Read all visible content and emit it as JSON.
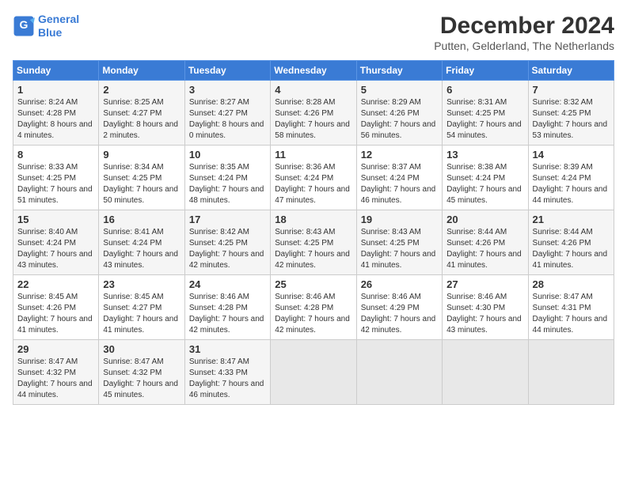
{
  "header": {
    "logo_line1": "General",
    "logo_line2": "Blue",
    "month": "December 2024",
    "location": "Putten, Gelderland, The Netherlands"
  },
  "weekdays": [
    "Sunday",
    "Monday",
    "Tuesday",
    "Wednesday",
    "Thursday",
    "Friday",
    "Saturday"
  ],
  "weeks": [
    [
      {
        "day": "1",
        "sunrise": "Sunrise: 8:24 AM",
        "sunset": "Sunset: 4:28 PM",
        "daylight": "Daylight: 8 hours and 4 minutes."
      },
      {
        "day": "2",
        "sunrise": "Sunrise: 8:25 AM",
        "sunset": "Sunset: 4:27 PM",
        "daylight": "Daylight: 8 hours and 2 minutes."
      },
      {
        "day": "3",
        "sunrise": "Sunrise: 8:27 AM",
        "sunset": "Sunset: 4:27 PM",
        "daylight": "Daylight: 8 hours and 0 minutes."
      },
      {
        "day": "4",
        "sunrise": "Sunrise: 8:28 AM",
        "sunset": "Sunset: 4:26 PM",
        "daylight": "Daylight: 7 hours and 58 minutes."
      },
      {
        "day": "5",
        "sunrise": "Sunrise: 8:29 AM",
        "sunset": "Sunset: 4:26 PM",
        "daylight": "Daylight: 7 hours and 56 minutes."
      },
      {
        "day": "6",
        "sunrise": "Sunrise: 8:31 AM",
        "sunset": "Sunset: 4:25 PM",
        "daylight": "Daylight: 7 hours and 54 minutes."
      },
      {
        "day": "7",
        "sunrise": "Sunrise: 8:32 AM",
        "sunset": "Sunset: 4:25 PM",
        "daylight": "Daylight: 7 hours and 53 minutes."
      }
    ],
    [
      {
        "day": "8",
        "sunrise": "Sunrise: 8:33 AM",
        "sunset": "Sunset: 4:25 PM",
        "daylight": "Daylight: 7 hours and 51 minutes."
      },
      {
        "day": "9",
        "sunrise": "Sunrise: 8:34 AM",
        "sunset": "Sunset: 4:25 PM",
        "daylight": "Daylight: 7 hours and 50 minutes."
      },
      {
        "day": "10",
        "sunrise": "Sunrise: 8:35 AM",
        "sunset": "Sunset: 4:24 PM",
        "daylight": "Daylight: 7 hours and 48 minutes."
      },
      {
        "day": "11",
        "sunrise": "Sunrise: 8:36 AM",
        "sunset": "Sunset: 4:24 PM",
        "daylight": "Daylight: 7 hours and 47 minutes."
      },
      {
        "day": "12",
        "sunrise": "Sunrise: 8:37 AM",
        "sunset": "Sunset: 4:24 PM",
        "daylight": "Daylight: 7 hours and 46 minutes."
      },
      {
        "day": "13",
        "sunrise": "Sunrise: 8:38 AM",
        "sunset": "Sunset: 4:24 PM",
        "daylight": "Daylight: 7 hours and 45 minutes."
      },
      {
        "day": "14",
        "sunrise": "Sunrise: 8:39 AM",
        "sunset": "Sunset: 4:24 PM",
        "daylight": "Daylight: 7 hours and 44 minutes."
      }
    ],
    [
      {
        "day": "15",
        "sunrise": "Sunrise: 8:40 AM",
        "sunset": "Sunset: 4:24 PM",
        "daylight": "Daylight: 7 hours and 43 minutes."
      },
      {
        "day": "16",
        "sunrise": "Sunrise: 8:41 AM",
        "sunset": "Sunset: 4:24 PM",
        "daylight": "Daylight: 7 hours and 43 minutes."
      },
      {
        "day": "17",
        "sunrise": "Sunrise: 8:42 AM",
        "sunset": "Sunset: 4:25 PM",
        "daylight": "Daylight: 7 hours and 42 minutes."
      },
      {
        "day": "18",
        "sunrise": "Sunrise: 8:43 AM",
        "sunset": "Sunset: 4:25 PM",
        "daylight": "Daylight: 7 hours and 42 minutes."
      },
      {
        "day": "19",
        "sunrise": "Sunrise: 8:43 AM",
        "sunset": "Sunset: 4:25 PM",
        "daylight": "Daylight: 7 hours and 41 minutes."
      },
      {
        "day": "20",
        "sunrise": "Sunrise: 8:44 AM",
        "sunset": "Sunset: 4:26 PM",
        "daylight": "Daylight: 7 hours and 41 minutes."
      },
      {
        "day": "21",
        "sunrise": "Sunrise: 8:44 AM",
        "sunset": "Sunset: 4:26 PM",
        "daylight": "Daylight: 7 hours and 41 minutes."
      }
    ],
    [
      {
        "day": "22",
        "sunrise": "Sunrise: 8:45 AM",
        "sunset": "Sunset: 4:26 PM",
        "daylight": "Daylight: 7 hours and 41 minutes."
      },
      {
        "day": "23",
        "sunrise": "Sunrise: 8:45 AM",
        "sunset": "Sunset: 4:27 PM",
        "daylight": "Daylight: 7 hours and 41 minutes."
      },
      {
        "day": "24",
        "sunrise": "Sunrise: 8:46 AM",
        "sunset": "Sunset: 4:28 PM",
        "daylight": "Daylight: 7 hours and 42 minutes."
      },
      {
        "day": "25",
        "sunrise": "Sunrise: 8:46 AM",
        "sunset": "Sunset: 4:28 PM",
        "daylight": "Daylight: 7 hours and 42 minutes."
      },
      {
        "day": "26",
        "sunrise": "Sunrise: 8:46 AM",
        "sunset": "Sunset: 4:29 PM",
        "daylight": "Daylight: 7 hours and 42 minutes."
      },
      {
        "day": "27",
        "sunrise": "Sunrise: 8:46 AM",
        "sunset": "Sunset: 4:30 PM",
        "daylight": "Daylight: 7 hours and 43 minutes."
      },
      {
        "day": "28",
        "sunrise": "Sunrise: 8:47 AM",
        "sunset": "Sunset: 4:31 PM",
        "daylight": "Daylight: 7 hours and 44 minutes."
      }
    ],
    [
      {
        "day": "29",
        "sunrise": "Sunrise: 8:47 AM",
        "sunset": "Sunset: 4:32 PM",
        "daylight": "Daylight: 7 hours and 44 minutes."
      },
      {
        "day": "30",
        "sunrise": "Sunrise: 8:47 AM",
        "sunset": "Sunset: 4:32 PM",
        "daylight": "Daylight: 7 hours and 45 minutes."
      },
      {
        "day": "31",
        "sunrise": "Sunrise: 8:47 AM",
        "sunset": "Sunset: 4:33 PM",
        "daylight": "Daylight: 7 hours and 46 minutes."
      },
      null,
      null,
      null,
      null
    ]
  ]
}
